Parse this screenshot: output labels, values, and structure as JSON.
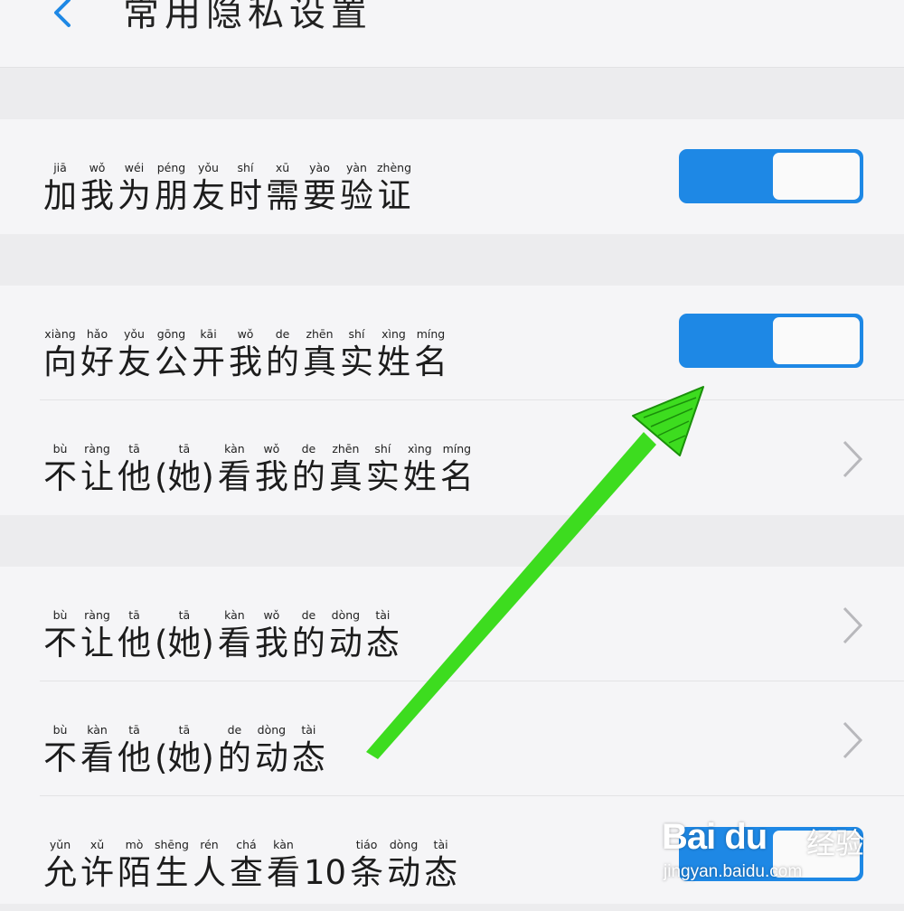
{
  "header": {
    "title": "常用隐私设置",
    "back_icon": "chevron-left-icon"
  },
  "colors": {
    "accent": "#1e88e5",
    "annotation_arrow": "#3ddc1f",
    "background": "#ececee",
    "card": "#f5f5f7"
  },
  "settings": {
    "verify_friend": {
      "chars": [
        [
          "加",
          "jiā"
        ],
        [
          "我",
          "wǒ"
        ],
        [
          "为",
          "wéi"
        ],
        [
          "朋",
          "péng"
        ],
        [
          "友",
          "yǒu"
        ],
        [
          "时",
          "shí"
        ],
        [
          "需",
          "xū"
        ],
        [
          "要",
          "yào"
        ],
        [
          "验",
          "yàn"
        ],
        [
          "证",
          "zhèng"
        ]
      ],
      "toggle_on": true
    },
    "public_real_name": {
      "chars": [
        [
          "向",
          "xiàng"
        ],
        [
          "好",
          "hǎo"
        ],
        [
          "友",
          "yǒu"
        ],
        [
          "公",
          "gōng"
        ],
        [
          "开",
          "kāi"
        ],
        [
          "我",
          "wǒ"
        ],
        [
          "的",
          "de"
        ],
        [
          "真",
          "zhēn"
        ],
        [
          "实",
          "shí"
        ],
        [
          "姓",
          "xìng"
        ],
        [
          "名",
          "míng"
        ]
      ],
      "toggle_on": true
    },
    "hide_real_name": {
      "chars": [
        [
          "不",
          "bù"
        ],
        [
          "让",
          "ràng"
        ],
        [
          "他",
          "tā"
        ],
        [
          "(她)",
          "tā"
        ],
        [
          "看",
          "kàn"
        ],
        [
          "我",
          "wǒ"
        ],
        [
          "的",
          "de"
        ],
        [
          "真",
          "zhēn"
        ],
        [
          "实",
          "shí"
        ],
        [
          "姓",
          "xìng"
        ],
        [
          "名",
          "míng"
        ]
      ]
    },
    "hide_moments": {
      "chars": [
        [
          "不",
          "bù"
        ],
        [
          "让",
          "ràng"
        ],
        [
          "他",
          "tā"
        ],
        [
          "(她)",
          "tā"
        ],
        [
          "看",
          "kàn"
        ],
        [
          "我",
          "wǒ"
        ],
        [
          "的",
          "de"
        ],
        [
          "动",
          "dòng"
        ],
        [
          "态",
          "tài"
        ]
      ]
    },
    "not_view_moments": {
      "chars": [
        [
          "不",
          "bù"
        ],
        [
          "看",
          "kàn"
        ],
        [
          "他",
          "tā"
        ],
        [
          "(她)",
          "tā"
        ],
        [
          "的",
          "de"
        ],
        [
          "动",
          "dòng"
        ],
        [
          "态",
          "tài"
        ]
      ]
    },
    "stranger_view": {
      "chars": [
        [
          "允",
          "yǔn"
        ],
        [
          "许",
          "xǔ"
        ],
        [
          "陌",
          "mò"
        ],
        [
          "生",
          "shēng"
        ],
        [
          "人",
          "rén"
        ],
        [
          "查",
          "chá"
        ],
        [
          "看",
          "kàn"
        ],
        [
          "10",
          ""
        ],
        [
          "条",
          "tiáo"
        ],
        [
          "动",
          "dòng"
        ],
        [
          "态",
          "tài"
        ]
      ],
      "toggle_on": true
    }
  },
  "watermark": {
    "logo": "Bai du",
    "brand": "经验",
    "url": "jingyan.baidu.com"
  }
}
